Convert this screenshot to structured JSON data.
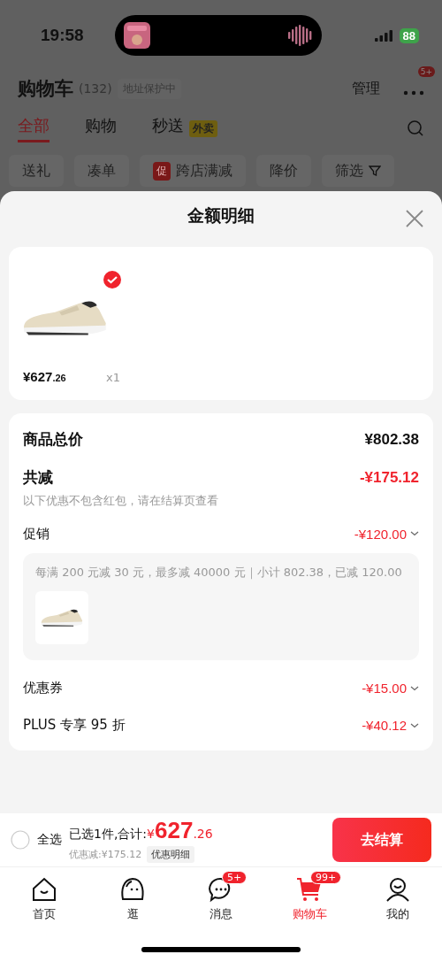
{
  "status_bar": {
    "time": "19:58",
    "battery": "88"
  },
  "header": {
    "title": "购物车",
    "count": "(132)",
    "address": "地址保护中",
    "manage": "管理",
    "more_badge": "5+"
  },
  "tabs": [
    {
      "label": "全部",
      "selected": true
    },
    {
      "label": "购物",
      "selected": false
    },
    {
      "label": "秒送",
      "badge": "外卖",
      "selected": false
    }
  ],
  "filters": [
    {
      "kind": "plain",
      "label": "送礼"
    },
    {
      "kind": "plain",
      "label": "凑单"
    },
    {
      "kind": "promo",
      "tag": "促",
      "label": "跨店满减"
    },
    {
      "kind": "plain",
      "label": "降价"
    },
    {
      "kind": "filter",
      "label": "筛选"
    }
  ],
  "sheet": {
    "title": "金额明细",
    "items": [
      {
        "price": "¥627",
        "price_decimal": ".26",
        "quantity": "x1",
        "checked": true
      }
    ],
    "total": {
      "label": "商品总价",
      "value": "¥802.38"
    },
    "total_discount": {
      "label": "共减",
      "value": "-¥175.12",
      "note": "以下优惠不包含红包，请在结算页查看"
    },
    "discounts": [
      {
        "label": "促销",
        "value": "-¥120.00",
        "detail": "每满 200 元减 30 元，最多减 40000 元｜小计 802.38，已减 120.00"
      },
      {
        "label": "优惠券",
        "value": "-¥15.00"
      },
      {
        "label": "PLUS 专享 95 折",
        "value": "-¥40.12"
      }
    ]
  },
  "bottom_bar": {
    "select_all": {
      "label": "全选",
      "checked": false
    },
    "summary": "已选1件,合计:",
    "currency": "¥",
    "amount": "627",
    "decimal": ".26",
    "discount": "优惠减:¥175.12",
    "detail_button": "优惠明细",
    "checkout": "去结算"
  },
  "nav": [
    {
      "kind": "home",
      "label": "首页",
      "selected": false
    },
    {
      "kind": "browse",
      "label": "逛",
      "selected": false
    },
    {
      "kind": "message",
      "label": "消息",
      "badge": "5+",
      "selected": false
    },
    {
      "kind": "cart",
      "label": "购物车",
      "badge": "99+",
      "selected": true
    },
    {
      "kind": "profile",
      "label": "我的",
      "selected": false
    }
  ]
}
